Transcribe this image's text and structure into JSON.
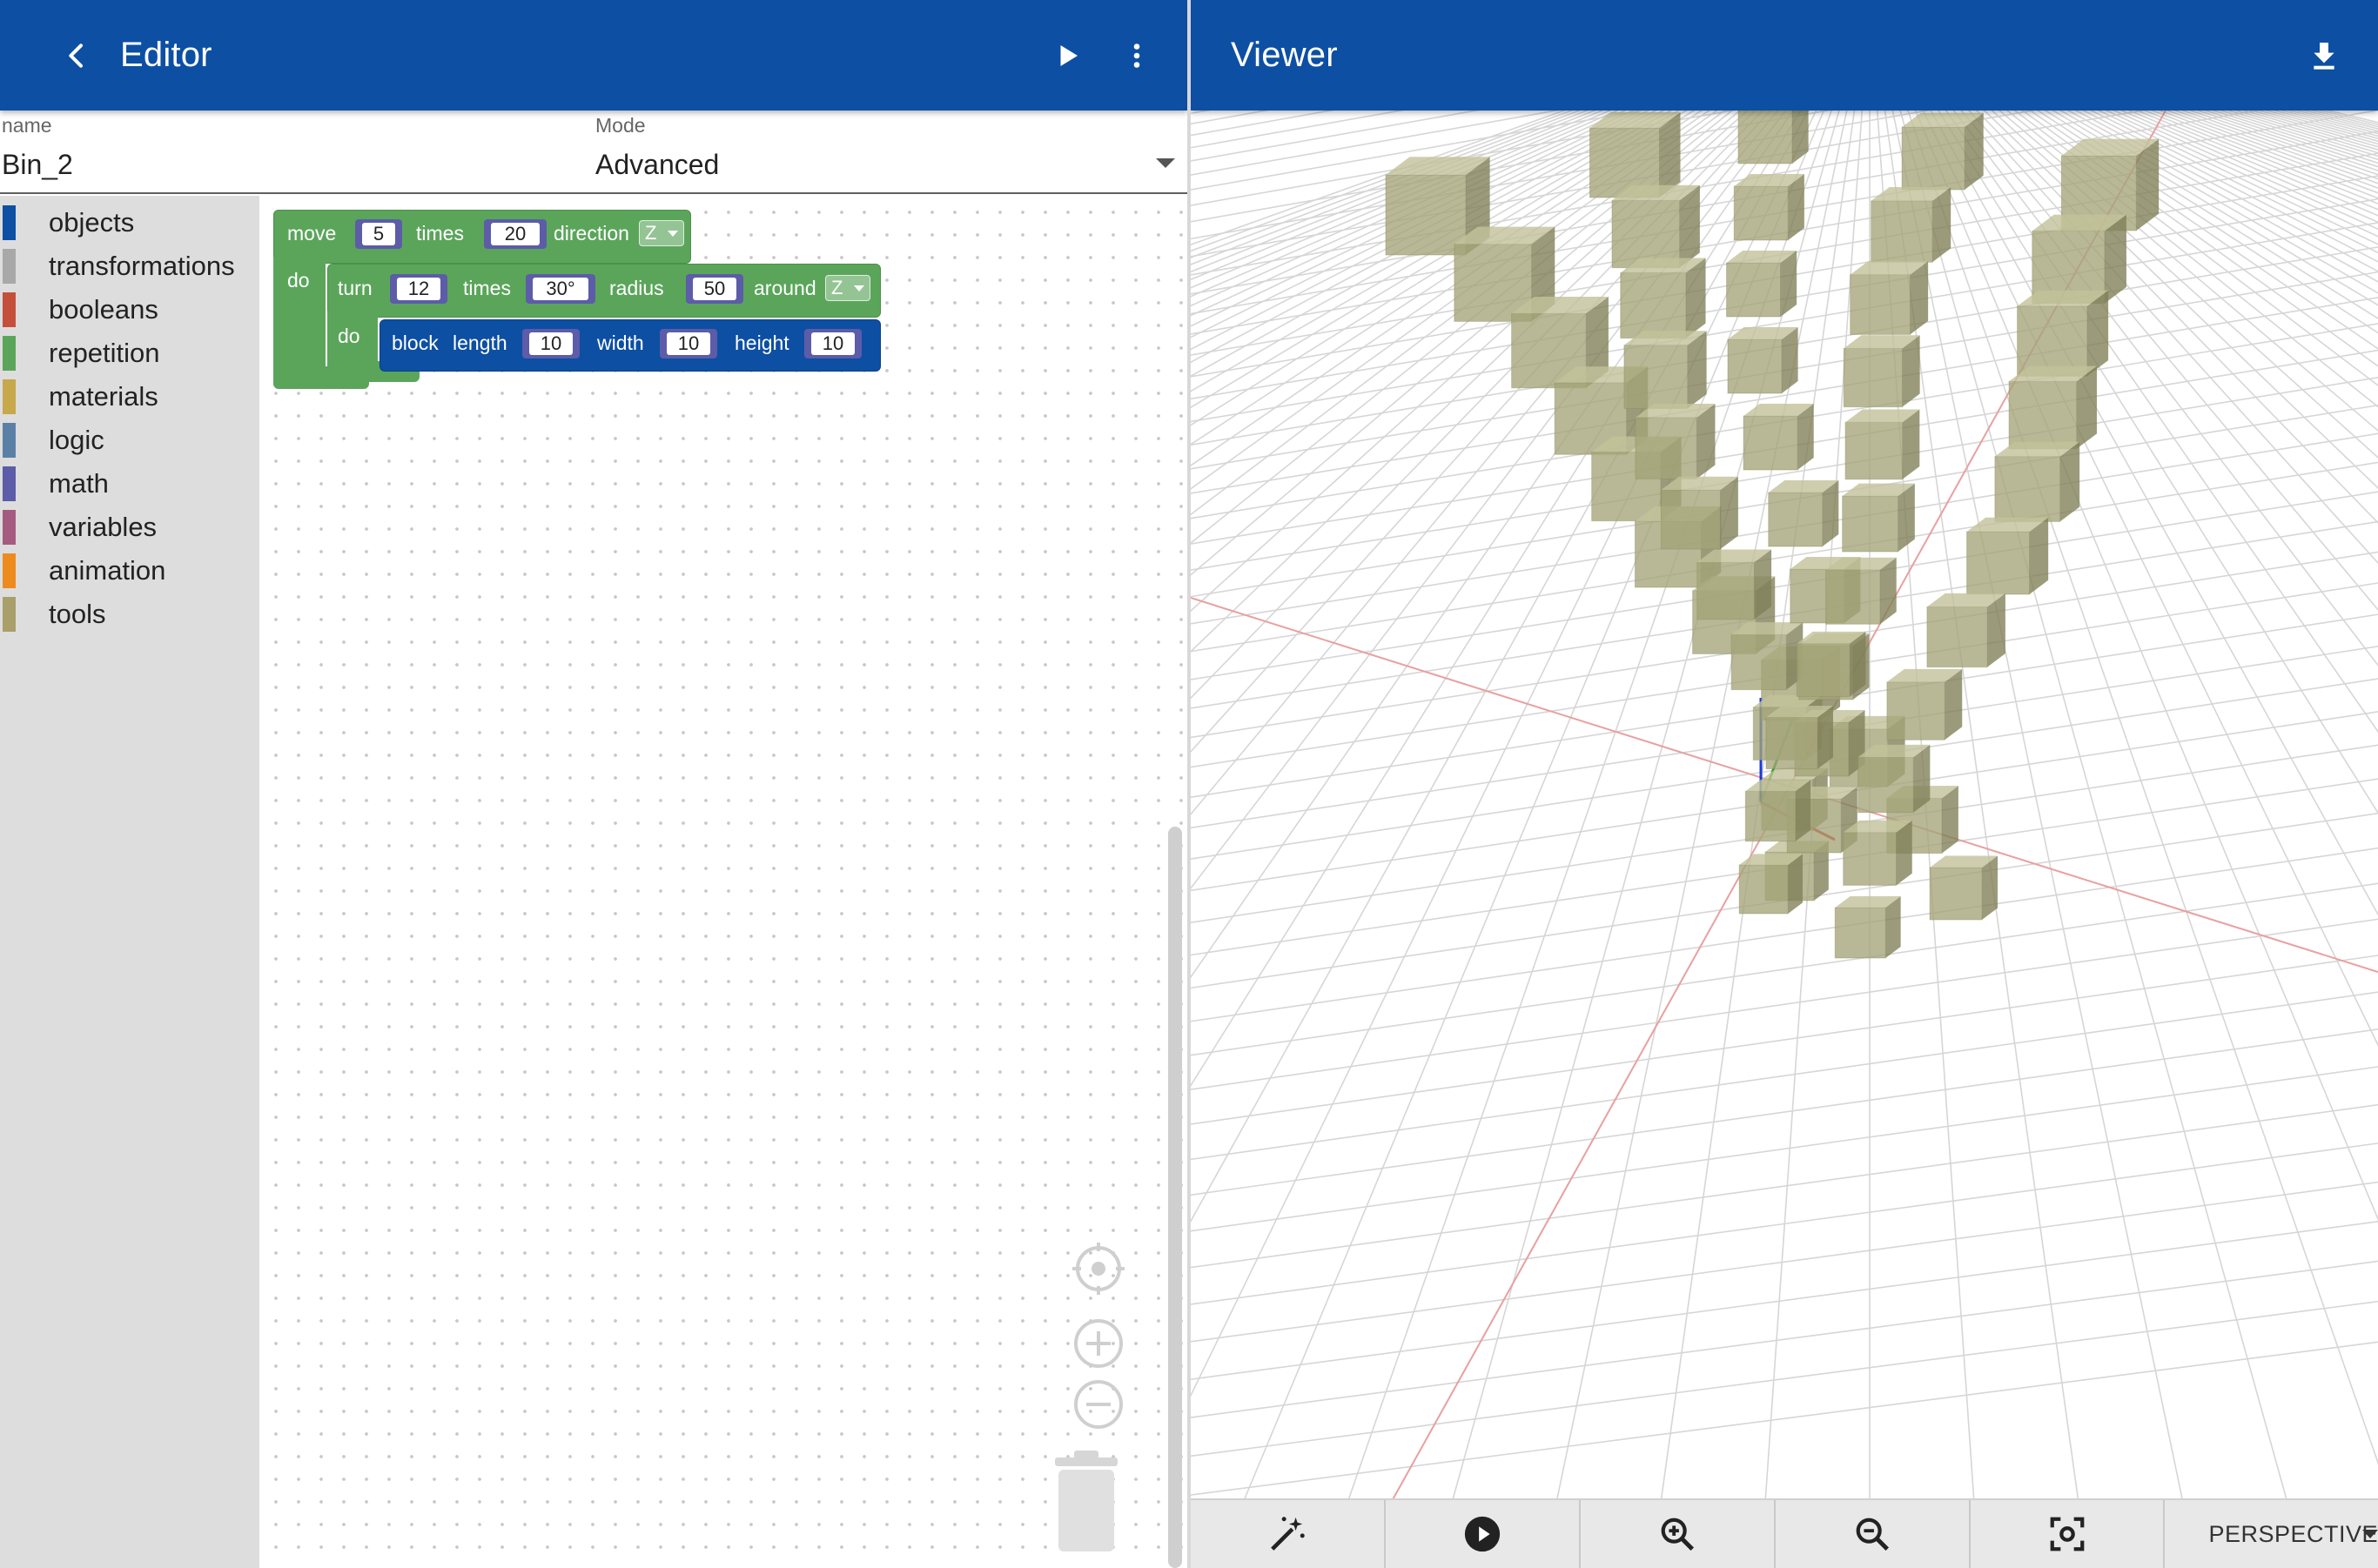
{
  "editor": {
    "title": "Editor",
    "name_label": "name",
    "name_value": "Bin_2",
    "mode_label": "Mode",
    "mode_value": "Advanced"
  },
  "viewer": {
    "title": "Viewer",
    "camera_mode": "PERSPECTIVE"
  },
  "colors": {
    "appbar": "#0d4fa3",
    "repetition_block": "#5ba55b",
    "objects_block": "#0d4fa3",
    "math_value": "#5c5ca8",
    "cube_fill": "#9a9a6c"
  },
  "toolbox": {
    "items": [
      {
        "label": "objects",
        "color": "#0d4fa3"
      },
      {
        "label": "transformations",
        "color": "#a8a8a8"
      },
      {
        "label": "booleans",
        "color": "#c4503a"
      },
      {
        "label": "repetition",
        "color": "#5ba55b"
      },
      {
        "label": "materials",
        "color": "#c7a84a"
      },
      {
        "label": "logic",
        "color": "#5b80a5"
      },
      {
        "label": "math",
        "color": "#5c5ca8"
      },
      {
        "label": "variables",
        "color": "#a55b80"
      },
      {
        "label": "animation",
        "color": "#ee8b1f"
      },
      {
        "label": "tools",
        "color": "#a89f6a"
      }
    ]
  },
  "blocks": {
    "move": {
      "label": "move",
      "count": "5",
      "times_label": "times",
      "distance": "20",
      "direction_label": "direction",
      "direction": "Z",
      "do_label": "do"
    },
    "turn": {
      "label": "turn",
      "count": "12",
      "times_label": "times",
      "angle": "30°",
      "radius_label": "radius",
      "radius": "50",
      "around_label": "around",
      "axis": "Z",
      "do_label": "do"
    },
    "block": {
      "label": "block",
      "length_label": "length",
      "length": "10",
      "width_label": "width",
      "width": "10",
      "height_label": "height",
      "height": "10"
    }
  },
  "icons": {
    "back": "chevron-left-icon",
    "run": "play-icon",
    "menu": "more-vert-icon",
    "download": "download-icon",
    "recenter": "target-icon",
    "zoom_in": "plus-circle-icon",
    "zoom_out": "minus-circle-icon",
    "trash": "trash-icon",
    "magic": "magic-wand-icon",
    "play_anim": "play-circle-icon",
    "viewer_zoom_in": "zoom-in-icon",
    "viewer_zoom_out": "zoom-out-icon",
    "fit": "focus-frame-icon"
  }
}
